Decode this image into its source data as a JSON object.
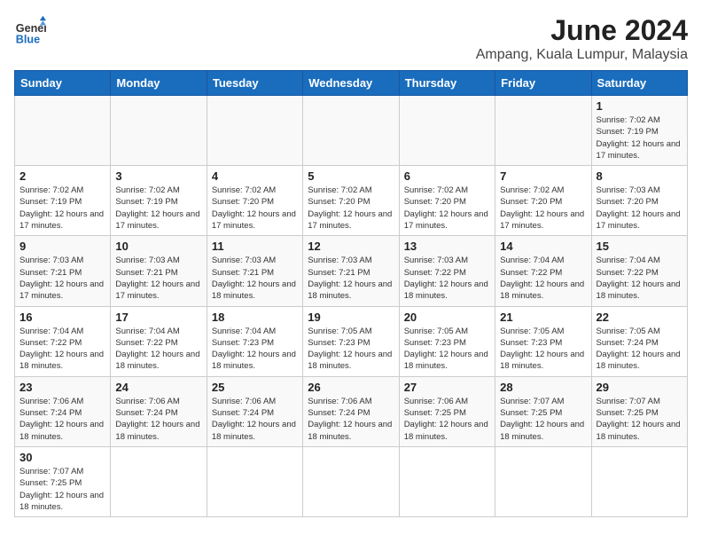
{
  "header": {
    "logo_general": "General",
    "logo_blue": "Blue",
    "title": "June 2024",
    "subtitle": "Ampang, Kuala Lumpur, Malaysia"
  },
  "days_of_week": [
    "Sunday",
    "Monday",
    "Tuesday",
    "Wednesday",
    "Thursday",
    "Friday",
    "Saturday"
  ],
  "weeks": [
    [
      {
        "day": "",
        "info": ""
      },
      {
        "day": "",
        "info": ""
      },
      {
        "day": "",
        "info": ""
      },
      {
        "day": "",
        "info": ""
      },
      {
        "day": "",
        "info": ""
      },
      {
        "day": "",
        "info": ""
      },
      {
        "day": "1",
        "info": "Sunrise: 7:02 AM\nSunset: 7:19 PM\nDaylight: 12 hours and 17 minutes."
      }
    ],
    [
      {
        "day": "2",
        "info": "Sunrise: 7:02 AM\nSunset: 7:19 PM\nDaylight: 12 hours and 17 minutes."
      },
      {
        "day": "3",
        "info": "Sunrise: 7:02 AM\nSunset: 7:19 PM\nDaylight: 12 hours and 17 minutes."
      },
      {
        "day": "4",
        "info": "Sunrise: 7:02 AM\nSunset: 7:20 PM\nDaylight: 12 hours and 17 minutes."
      },
      {
        "day": "5",
        "info": "Sunrise: 7:02 AM\nSunset: 7:20 PM\nDaylight: 12 hours and 17 minutes."
      },
      {
        "day": "6",
        "info": "Sunrise: 7:02 AM\nSunset: 7:20 PM\nDaylight: 12 hours and 17 minutes."
      },
      {
        "day": "7",
        "info": "Sunrise: 7:02 AM\nSunset: 7:20 PM\nDaylight: 12 hours and 17 minutes."
      },
      {
        "day": "8",
        "info": "Sunrise: 7:03 AM\nSunset: 7:20 PM\nDaylight: 12 hours and 17 minutes."
      }
    ],
    [
      {
        "day": "9",
        "info": "Sunrise: 7:03 AM\nSunset: 7:21 PM\nDaylight: 12 hours and 17 minutes."
      },
      {
        "day": "10",
        "info": "Sunrise: 7:03 AM\nSunset: 7:21 PM\nDaylight: 12 hours and 17 minutes."
      },
      {
        "day": "11",
        "info": "Sunrise: 7:03 AM\nSunset: 7:21 PM\nDaylight: 12 hours and 18 minutes."
      },
      {
        "day": "12",
        "info": "Sunrise: 7:03 AM\nSunset: 7:21 PM\nDaylight: 12 hours and 18 minutes."
      },
      {
        "day": "13",
        "info": "Sunrise: 7:03 AM\nSunset: 7:22 PM\nDaylight: 12 hours and 18 minutes."
      },
      {
        "day": "14",
        "info": "Sunrise: 7:04 AM\nSunset: 7:22 PM\nDaylight: 12 hours and 18 minutes."
      },
      {
        "day": "15",
        "info": "Sunrise: 7:04 AM\nSunset: 7:22 PM\nDaylight: 12 hours and 18 minutes."
      }
    ],
    [
      {
        "day": "16",
        "info": "Sunrise: 7:04 AM\nSunset: 7:22 PM\nDaylight: 12 hours and 18 minutes."
      },
      {
        "day": "17",
        "info": "Sunrise: 7:04 AM\nSunset: 7:22 PM\nDaylight: 12 hours and 18 minutes."
      },
      {
        "day": "18",
        "info": "Sunrise: 7:04 AM\nSunset: 7:23 PM\nDaylight: 12 hours and 18 minutes."
      },
      {
        "day": "19",
        "info": "Sunrise: 7:05 AM\nSunset: 7:23 PM\nDaylight: 12 hours and 18 minutes."
      },
      {
        "day": "20",
        "info": "Sunrise: 7:05 AM\nSunset: 7:23 PM\nDaylight: 12 hours and 18 minutes."
      },
      {
        "day": "21",
        "info": "Sunrise: 7:05 AM\nSunset: 7:23 PM\nDaylight: 12 hours and 18 minutes."
      },
      {
        "day": "22",
        "info": "Sunrise: 7:05 AM\nSunset: 7:24 PM\nDaylight: 12 hours and 18 minutes."
      }
    ],
    [
      {
        "day": "23",
        "info": "Sunrise: 7:06 AM\nSunset: 7:24 PM\nDaylight: 12 hours and 18 minutes."
      },
      {
        "day": "24",
        "info": "Sunrise: 7:06 AM\nSunset: 7:24 PM\nDaylight: 12 hours and 18 minutes."
      },
      {
        "day": "25",
        "info": "Sunrise: 7:06 AM\nSunset: 7:24 PM\nDaylight: 12 hours and 18 minutes."
      },
      {
        "day": "26",
        "info": "Sunrise: 7:06 AM\nSunset: 7:24 PM\nDaylight: 12 hours and 18 minutes."
      },
      {
        "day": "27",
        "info": "Sunrise: 7:06 AM\nSunset: 7:25 PM\nDaylight: 12 hours and 18 minutes."
      },
      {
        "day": "28",
        "info": "Sunrise: 7:07 AM\nSunset: 7:25 PM\nDaylight: 12 hours and 18 minutes."
      },
      {
        "day": "29",
        "info": "Sunrise: 7:07 AM\nSunset: 7:25 PM\nDaylight: 12 hours and 18 minutes."
      }
    ],
    [
      {
        "day": "30",
        "info": "Sunrise: 7:07 AM\nSunset: 7:25 PM\nDaylight: 12 hours and 18 minutes."
      },
      {
        "day": "",
        "info": ""
      },
      {
        "day": "",
        "info": ""
      },
      {
        "day": "",
        "info": ""
      },
      {
        "day": "",
        "info": ""
      },
      {
        "day": "",
        "info": ""
      },
      {
        "day": "",
        "info": ""
      }
    ]
  ]
}
